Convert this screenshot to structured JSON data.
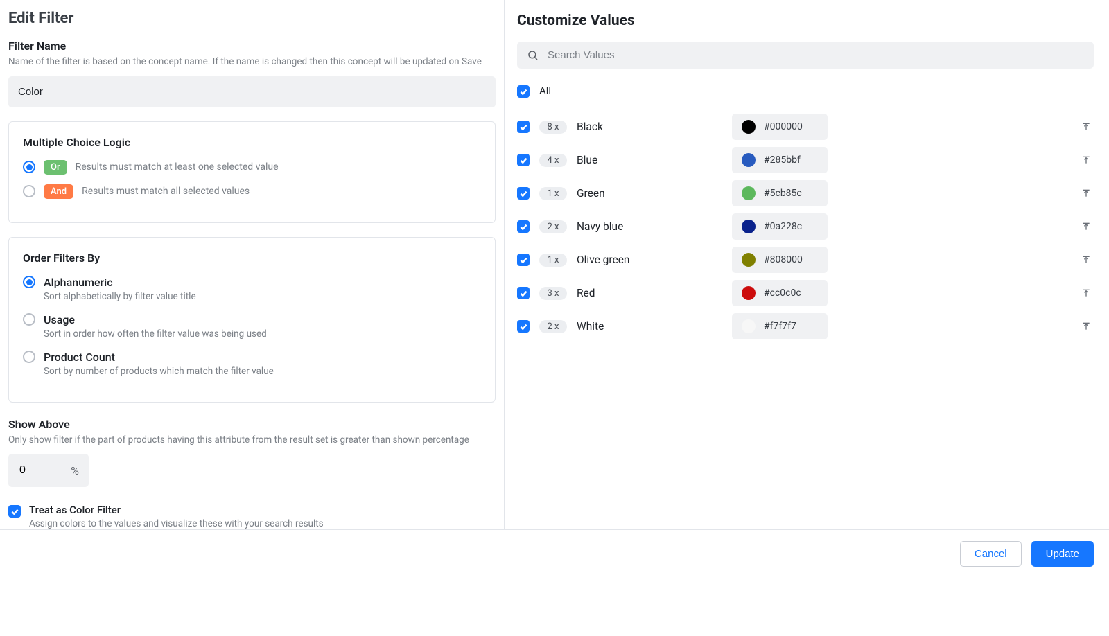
{
  "left": {
    "title": "Edit Filter",
    "filter_name": {
      "label": "Filter Name",
      "help": "Name of the filter is based on the concept name. If the name is changed then this concept will be updated on Save",
      "value": "Color"
    },
    "logic": {
      "title": "Multiple Choice Logic",
      "options": [
        {
          "key": "or",
          "pill": "Or",
          "pill_class": "or",
          "desc": "Results must match at least one selected value",
          "selected": true
        },
        {
          "key": "and",
          "pill": "And",
          "pill_class": "and",
          "desc": "Results must match all selected values",
          "selected": false
        }
      ]
    },
    "order": {
      "title": "Order Filters By",
      "options": [
        {
          "key": "alpha",
          "title": "Alphanumeric",
          "sub": "Sort alphabetically by filter value title",
          "selected": true
        },
        {
          "key": "usage",
          "title": "Usage",
          "sub": "Sort in order how often the filter value was being used",
          "selected": false
        },
        {
          "key": "prod",
          "title": "Product Count",
          "sub": "Sort by number of products which match the filter value",
          "selected": false
        }
      ]
    },
    "show_above": {
      "label": "Show Above",
      "help": "Only show filter if the part of products having this attribute from the result set is greater than shown percentage",
      "value": "0",
      "suffix": "%"
    },
    "color_filter": {
      "label": "Treat as Color Filter",
      "sub": "Assign colors to the values and visualize these with your search results",
      "checked": true
    }
  },
  "right": {
    "title": "Customize Values",
    "search_placeholder": "Search Values",
    "all_label": "All",
    "values": [
      {
        "count": "8 x",
        "name": "Black",
        "hex": "#000000",
        "checked": true
      },
      {
        "count": "4 x",
        "name": "Blue",
        "hex": "#285bbf",
        "checked": true
      },
      {
        "count": "1 x",
        "name": "Green",
        "hex": "#5cb85c",
        "checked": true
      },
      {
        "count": "2 x",
        "name": "Navy blue",
        "hex": "#0a228c",
        "checked": true
      },
      {
        "count": "1 x",
        "name": "Olive green",
        "hex": "#808000",
        "checked": true
      },
      {
        "count": "3 x",
        "name": "Red",
        "hex": "#cc0c0c",
        "checked": true
      },
      {
        "count": "2 x",
        "name": "White",
        "hex": "#f7f7f7",
        "checked": true
      }
    ]
  },
  "footer": {
    "cancel": "Cancel",
    "update": "Update"
  }
}
